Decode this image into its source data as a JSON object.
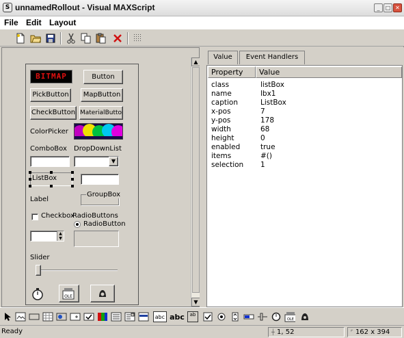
{
  "window": {
    "title": "unnamedRollout - Visual MAXScript",
    "app_icon": "maxscript-icon"
  },
  "menu": [
    "File",
    "Edit",
    "Layout"
  ],
  "toolbar": {
    "buttons": [
      "new-icon",
      "open-icon",
      "save-icon",
      "cut-icon",
      "copy-icon",
      "paste-icon",
      "delete-icon",
      "grid-icon"
    ]
  },
  "rollout": {
    "bitmap_text": "BITMAP",
    "button": "Button",
    "pickbutton": "PickButton",
    "mapbutton": "MapButton",
    "checkbutton": "CheckButton",
    "materialbutton": "MaterialButton",
    "colorpicker": "ColorPicker",
    "combobox": "ComboBox",
    "dropdownlist": "DropDownList",
    "listbox": "ListBox",
    "label": "Label",
    "groupbox": "GroupBox",
    "checkbox": "Checkbox",
    "radiobuttons": "RadioButtons",
    "radiobutton": "RadioButton",
    "slider": "Slider",
    "ole_text": "OLE"
  },
  "props": {
    "tabs": [
      "Value",
      "Event Handlers"
    ],
    "headers": [
      "Property",
      "Value"
    ],
    "rows": [
      {
        "name": "class",
        "value": "listBox"
      },
      {
        "name": "name",
        "value": "lbx1"
      },
      {
        "name": "caption",
        "value": "ListBox"
      },
      {
        "name": "x-pos",
        "value": "7"
      },
      {
        "name": "y-pos",
        "value": "178"
      },
      {
        "name": "width",
        "value": "68"
      },
      {
        "name": "height",
        "value": "0"
      },
      {
        "name": "enabled",
        "value": "true"
      },
      {
        "name": "items",
        "value": "#()"
      },
      {
        "name": "selection",
        "value": "1"
      }
    ]
  },
  "palette": {
    "abc": "abc",
    "ab": "ab",
    "ole": "OLE"
  },
  "status": {
    "text": "Ready",
    "position": "1, 52",
    "size": "162 x 394"
  }
}
